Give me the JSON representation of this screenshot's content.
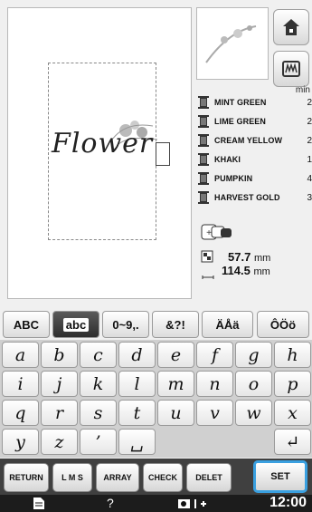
{
  "preview": {
    "text": "Flower"
  },
  "colors": {
    "unit_label": "min",
    "items": [
      {
        "name": "MINT GREEN",
        "num": "2",
        "swatch": "#777777"
      },
      {
        "name": "LIME GREEN",
        "num": "2",
        "swatch": "#777777"
      },
      {
        "name": "CREAM YELLOW",
        "num": "2",
        "swatch": "#777777"
      },
      {
        "name": "KHAKI",
        "num": "1",
        "swatch": "#777777"
      },
      {
        "name": "PUMPKIN",
        "num": "4",
        "swatch": "#777777"
      },
      {
        "name": "HARVEST GOLD",
        "num": "3",
        "swatch": "#777777"
      }
    ]
  },
  "size": {
    "height": "57.7",
    "width": "114.5",
    "unit": "mm"
  },
  "tabs": [
    {
      "label": "ABC",
      "active": false
    },
    {
      "label": "abc",
      "active": true
    },
    {
      "label": "0~9,.",
      "active": false
    },
    {
      "label": "&?!",
      "active": false
    },
    {
      "label": "ÄÅä",
      "active": false
    },
    {
      "label": "ÔÖö",
      "active": false
    }
  ],
  "keys": [
    [
      "a",
      "b",
      "c",
      "d",
      "e",
      "f",
      "g",
      "h"
    ],
    [
      "i",
      "j",
      "k",
      "l",
      "m",
      "n",
      "o",
      "p"
    ],
    [
      "q",
      "r",
      "s",
      "t",
      "u",
      "v",
      "w",
      "x"
    ],
    [
      "y",
      "z",
      "’",
      "␣",
      "",
      "",
      "",
      "↵"
    ]
  ],
  "functions": {
    "return": "RETURN",
    "lms": "L M S",
    "array": "ARRAY",
    "check": "CHECK",
    "delete": "DELET",
    "set": "SET"
  },
  "status": {
    "time": "12:00",
    "help": "?"
  },
  "accent_color": "#3aa0e0"
}
